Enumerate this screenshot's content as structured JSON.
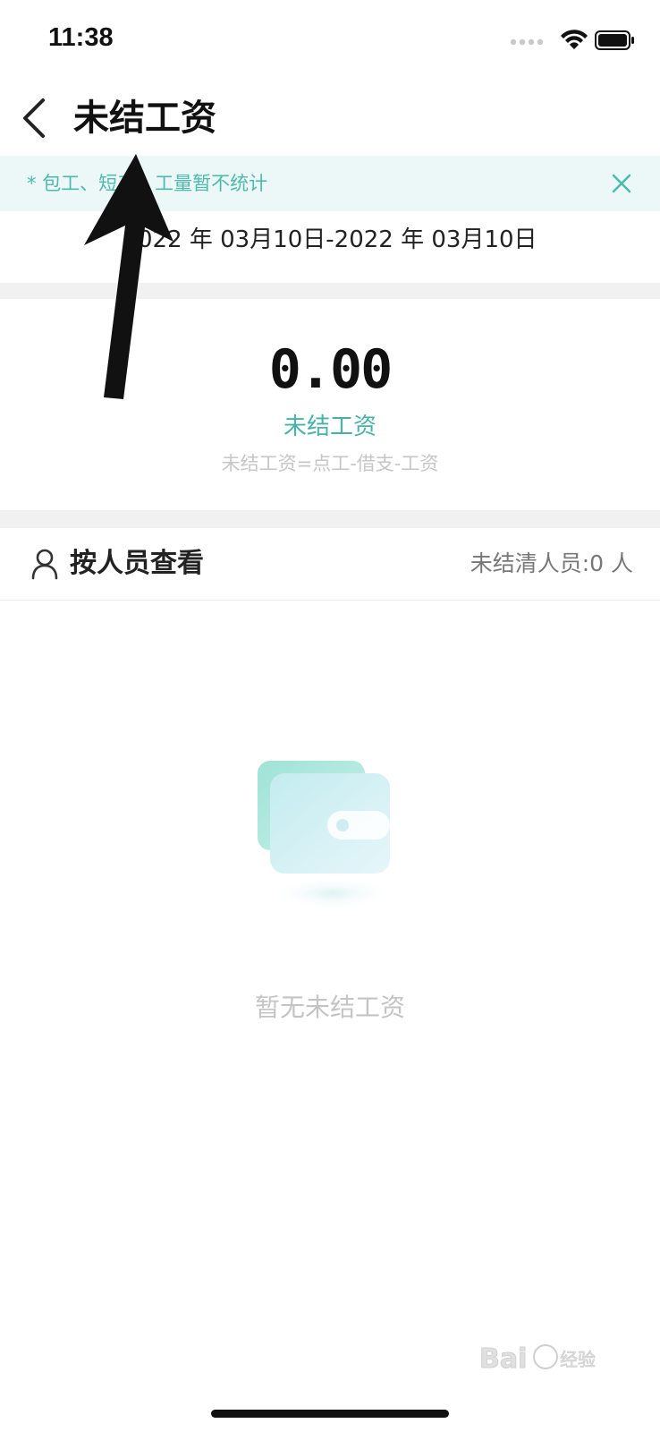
{
  "status_bar": {
    "time": "11:38"
  },
  "nav": {
    "title": "未结工资",
    "back_icon": "chevron-left-icon"
  },
  "notice": {
    "text": "* 包工、短工、工量暂不统计",
    "close_icon": "close-icon"
  },
  "date_range": "2022 年 03月10日-2022 年 03月10日",
  "summary": {
    "amount": "0.00",
    "label": "未结工资",
    "formula": "未结工资=点工-借支-工资"
  },
  "section": {
    "title": "按人员查看",
    "unsettled": "未结清人员:0 人",
    "icon": "person-icon"
  },
  "empty": {
    "text": "暂无未结工资",
    "icon": "wallet-icon"
  },
  "colors": {
    "accent": "#47b3a7",
    "notice_bg": "#ebf8f7",
    "divider_bg": "#f1f1f1"
  }
}
